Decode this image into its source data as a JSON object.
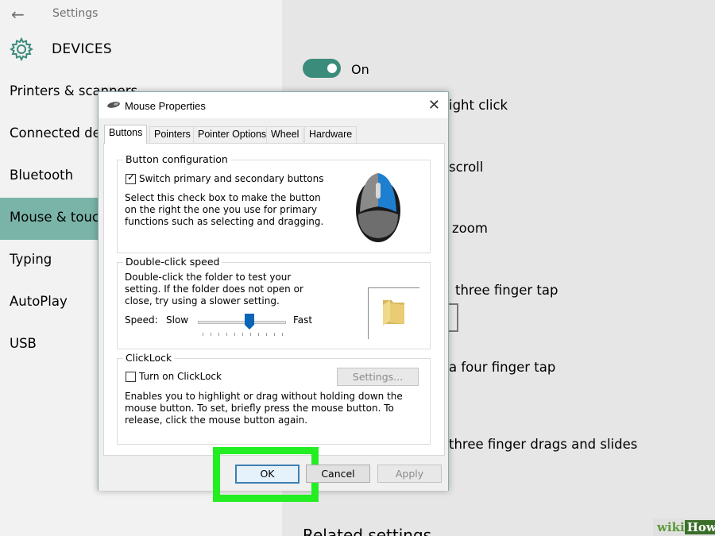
{
  "settings": {
    "back_icon": "back-arrow-icon",
    "app_title": "Settings",
    "gear_icon": "gear-icon",
    "section_title": "DEVICES",
    "nav_items": [
      {
        "label": "Printers & scanners"
      },
      {
        "label": "Connected devices"
      },
      {
        "label": "Bluetooth"
      },
      {
        "label": "Mouse & touchpad"
      },
      {
        "label": "Typing"
      },
      {
        "label": "AutoPlay"
      },
      {
        "label": "USB"
      }
    ],
    "active_nav_index": 3,
    "accent_color": "#3c8c7c",
    "content": {
      "toggle_label": "On",
      "right_click": "ight click",
      "scroll": "scroll",
      "zoom": "zoom",
      "three_finger_tap": "three finger tap",
      "four_finger_tap": "a four finger tap",
      "three_finger_drags": "three finger drags and slides",
      "related_settings": "Related settings"
    }
  },
  "dialog": {
    "title": "Mouse Properties",
    "close_icon": "close-icon",
    "tabs": [
      {
        "label": "Buttons"
      },
      {
        "label": "Pointers"
      },
      {
        "label": "Pointer Options"
      },
      {
        "label": "Wheel"
      },
      {
        "label": "Hardware"
      }
    ],
    "active_tab_index": 0,
    "button_config": {
      "title": "Button configuration",
      "checkbox_label": "Switch primary and secondary buttons",
      "checked": true,
      "description": "Select this check box to make the button on the right the one you use for primary functions such as selecting and dragging.",
      "mouse_icon": "mouse-icon"
    },
    "double_click": {
      "title": "Double-click speed",
      "description": "Double-click the folder to test your setting. If the folder does not open or close, try using a slower setting.",
      "speed_label": "Speed:",
      "slow_label": "Slow",
      "fast_label": "Fast",
      "speed_value": 0.6,
      "folder_icon": "folder-icon"
    },
    "clicklock": {
      "title": "ClickLock",
      "checkbox_label": "Turn on ClickLock",
      "checked": false,
      "settings_button": "Settings...",
      "description": "Enables you to highlight or drag without holding down the mouse button. To set, briefly press the mouse button. To release, click the mouse button again."
    },
    "buttons": {
      "ok": "OK",
      "cancel": "Cancel",
      "apply": "Apply"
    },
    "highlight_color": "#22ee22"
  },
  "watermark": {
    "wiki": "wiki",
    "how": "How"
  }
}
